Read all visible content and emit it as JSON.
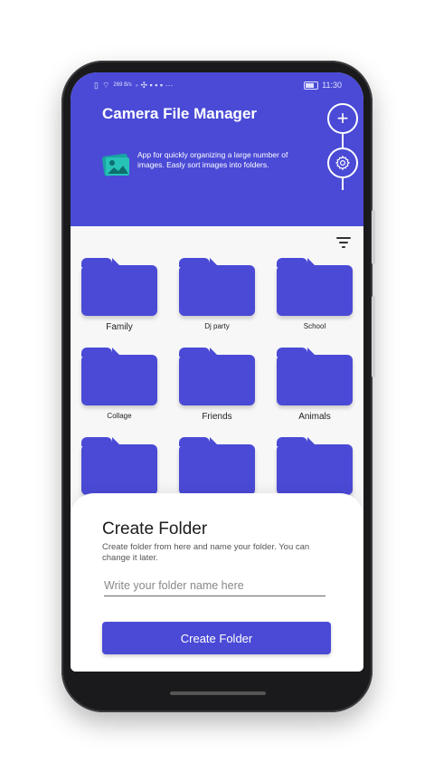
{
  "status_bar": {
    "time": "11:30",
    "net": "269 B/s"
  },
  "header": {
    "title": "Camera File Manager",
    "description": "App for quickly organizing a large number of images. Easly sort images into folders.",
    "plus_glyph": "+",
    "accent": "#4a4ad6"
  },
  "folders": [
    {
      "label": "Family"
    },
    {
      "label": "Dj party"
    },
    {
      "label": "School"
    },
    {
      "label": "Collage"
    },
    {
      "label": "Friends"
    },
    {
      "label": "Animals"
    },
    {
      "label": ""
    },
    {
      "label": ""
    },
    {
      "label": ""
    }
  ],
  "sheet": {
    "title": "Create Folder",
    "description": "Create folder from here and name your folder. You can change it later.",
    "input_placeholder": "Write your folder name here",
    "button_label": "Create Folder"
  },
  "icons": [
    "plus-icon",
    "gear-icon",
    "gallery-icon",
    "filter-icon",
    "wifi-icon",
    "battery-icon"
  ]
}
